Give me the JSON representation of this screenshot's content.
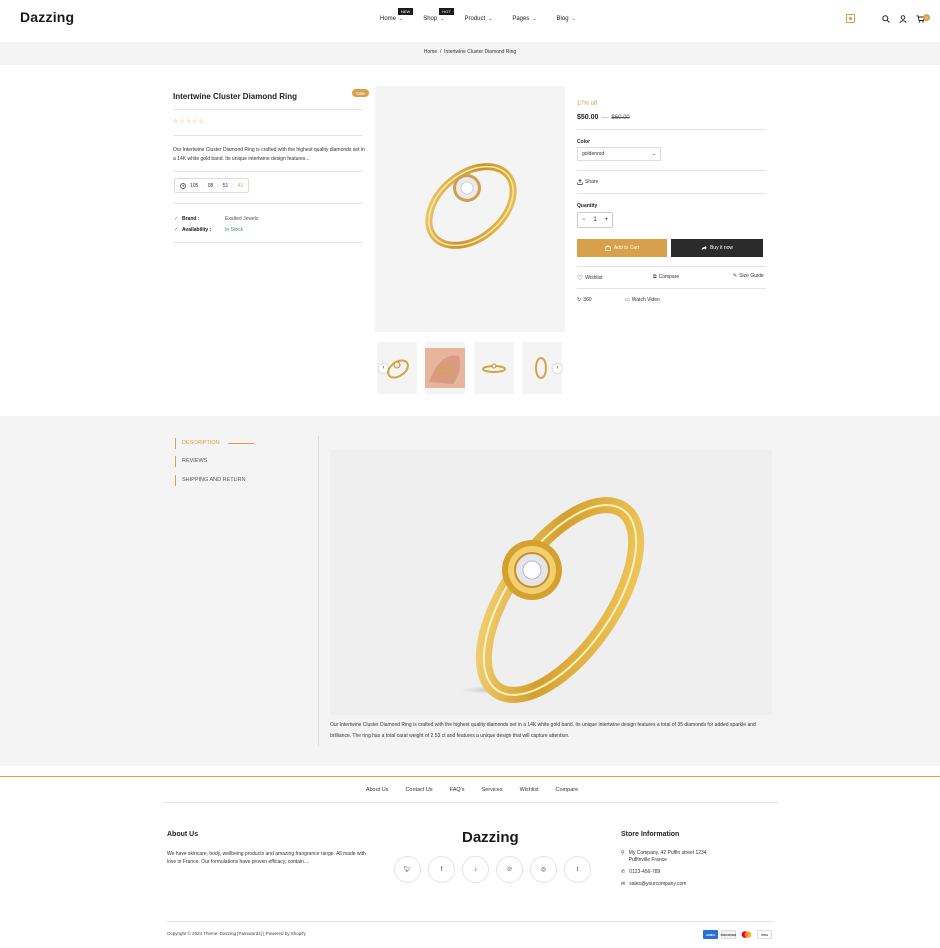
{
  "header": {
    "logo": "Dazzing",
    "nav": [
      {
        "label": "Home",
        "badge": "NEW"
      },
      {
        "label": "Shop",
        "badge": "HOT"
      },
      {
        "label": "Product",
        "badge": ""
      },
      {
        "label": "Pages",
        "badge": ""
      },
      {
        "label": "Blog",
        "badge": ""
      }
    ],
    "cart_count": "0"
  },
  "breadcrumb": {
    "home": "Home",
    "sep": "/",
    "current": "Intertwine Cluster Diamond Ring"
  },
  "product": {
    "title": "Intertwine Cluster Diamond Ring",
    "sale_label": "Sale",
    "rating_stars": "☆☆☆☆☆",
    "description": "Our Intertwine Cluster Diamond Ring is crafted with the highest quality diamonds set in a 14K white gold band. Its unique intertwine design features...",
    "timer": {
      "days": "105",
      "hours": "08",
      "minutes": "51",
      "seconds": "41"
    },
    "brand_label": "Brand :",
    "brand_value": "Exalted Jewels",
    "availability_label": "Availability :",
    "availability_value": "In Stock",
    "discount": "17% off",
    "price": "$50.00",
    "price_dash": "—",
    "compare_price": "$60.00",
    "color_label": "Color",
    "color_value": "goldenrod",
    "share_label": "Share",
    "quantity_label": "Quantity",
    "quantity_value": "1",
    "add_to_cart": "Add to Cart",
    "buy_now": "Buy it now",
    "wishlist": "Wishlist",
    "compare": "Compare",
    "size_guide": "Size Guide",
    "view_360": "360",
    "watch_video": "Watch Video",
    "accent": "#d9a04b"
  },
  "tabs": {
    "items": [
      "DESCRIPTION",
      "REVIEWS",
      "SHIPPING AND RETURN"
    ],
    "active": "DESCRIPTION",
    "long_description": "Our Intertwine Cluster Diamond Ring is crafted with the highest quality diamonds set in a 14K white gold band. Its unique intertwine design features a total of 35 diamonds for added sparkle and brilliance. The ring has a total carat weight of 2.53 ct and features a unique design that will capture attention."
  },
  "footer": {
    "links": [
      "About Us",
      "Contact Us",
      "FAQ's",
      "Services",
      "Wishlist",
      "Compare"
    ],
    "about_title": "About Us",
    "about_text": "We have skincare, body, wellbeing products and amazing frangrance range. All made with love in France. Our formulations have proven efficacy, contain....",
    "logo": "Dazzing",
    "social": [
      "twitter-icon",
      "facebook-icon",
      "tiktok-icon",
      "pinterest-icon",
      "instagram-icon",
      "tumblr-icon"
    ],
    "store_title": "Store Information",
    "address_line1": "My Company, 42 Puffin street 1234",
    "address_line2": "Puffinville France",
    "phone": "0123-456-789",
    "email": "sales@yourcompany.com",
    "copyright": "Copyright © 2024 Theme: Dazzing [Password1] | Powered by Shopify",
    "payments": [
      "AMEX",
      "DISCOVER",
      "mastercard",
      "VISA"
    ]
  }
}
